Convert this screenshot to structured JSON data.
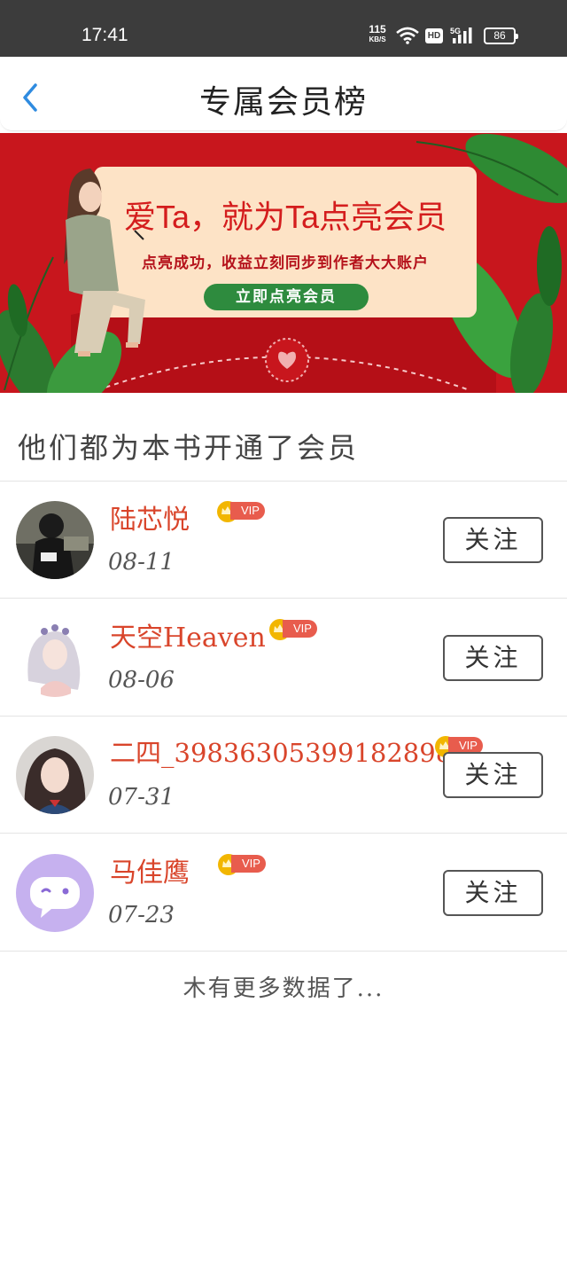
{
  "status_bar": {
    "time": "17:41",
    "net_speed_value": "115",
    "net_speed_unit": "KB/S",
    "hd": "HD",
    "network": "5G",
    "battery": "86"
  },
  "header": {
    "title": "专属会员榜",
    "back_icon": "chevron-left-icon"
  },
  "banner": {
    "headline": "爱Ta，就为Ta点亮会员",
    "subline": "点亮成功，收益立刻同步到作者大大账户",
    "cta": "立即点亮会员",
    "colors": {
      "background": "#c8161d",
      "card": "#fde3c6",
      "cta": "#2e8b3e"
    }
  },
  "section": {
    "heading": "他们都为本书开通了会员"
  },
  "members": [
    {
      "name": "陆芯悦",
      "badge": "VIP",
      "date": "08-11",
      "follow": "关注",
      "avatar": "dark-photo-avatar"
    },
    {
      "name": "天空Heaven",
      "badge": "VIP",
      "date": "08-06",
      "follow": "关注",
      "avatar": "anime-girl-avatar"
    },
    {
      "name": "二四_398363053991828​98",
      "badge": "VIP",
      "date": "07-31",
      "follow": "关注",
      "avatar": "anime-girl-avatar"
    },
    {
      "name": "马佳鹰",
      "badge": "VIP",
      "date": "07-23",
      "follow": "关注",
      "avatar": "default-chat-avatar"
    }
  ],
  "footer": {
    "text": "木有更多数据了..."
  },
  "colors": {
    "accent": "#2f8be0",
    "name": "#d9452b",
    "vip": "#e85c4d",
    "crown": "#f2b600"
  }
}
